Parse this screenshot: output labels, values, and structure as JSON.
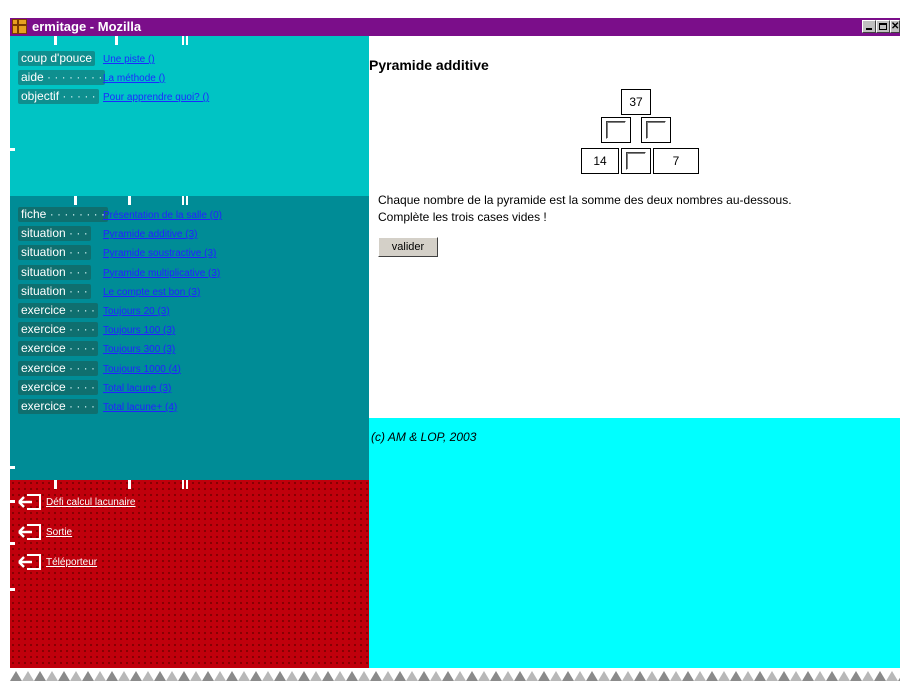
{
  "window": {
    "title": "ermitage - Mozilla"
  },
  "help": {
    "items": [
      {
        "tag": "coup d'pouce",
        "dots": "",
        "link": "Une piste ()"
      },
      {
        "tag": "aide",
        "dots": " · · · · · · · ·",
        "link": "La méthode ()"
      },
      {
        "tag": "objectif",
        "dots": " · · · · ·",
        "link": "Pour apprendre quoi? ()"
      }
    ]
  },
  "activities": {
    "items": [
      {
        "tag": "fiche",
        "dots": " · · · · · · · ·",
        "link": "Présentation de la salle (0)"
      },
      {
        "tag": "situation",
        "dots": " · · ·",
        "link": "Pyramide additive (3)"
      },
      {
        "tag": "situation",
        "dots": " · · ·",
        "link": "Pyramide soustractive (3)"
      },
      {
        "tag": "situation",
        "dots": " · · ·",
        "link": "Pyramide multiplicative (3)"
      },
      {
        "tag": "situation",
        "dots": " · · ·",
        "link": "Le compte est bon (3)"
      },
      {
        "tag": "exercice",
        "dots": " · · · ·",
        "link": "Toujours 20 (3)"
      },
      {
        "tag": "exercice",
        "dots": " · · · ·",
        "link": "Toujours 100 (3)"
      },
      {
        "tag": "exercice",
        "dots": " · · · ·",
        "link": "Toujours 300 (3)"
      },
      {
        "tag": "exercice",
        "dots": " · · · ·",
        "link": "Toujours 1000 (4)"
      },
      {
        "tag": "exercice",
        "dots": " · · · ·",
        "link": "Total lacune (3)"
      },
      {
        "tag": "exercice",
        "dots": " · · · ·",
        "link": "Total lacune+ (4)"
      }
    ]
  },
  "exits": {
    "items": [
      {
        "label": "Défi calcul lacunaire",
        "icon": "exit-door-icon"
      },
      {
        "label": "Sortie",
        "icon": "exit-door-icon"
      },
      {
        "label": "Téléporteur",
        "icon": "exit-door-icon"
      }
    ]
  },
  "exercise": {
    "title": "Pyramide additive",
    "pyramid": {
      "top": "37",
      "middle": [
        "",
        ""
      ],
      "bottom": [
        "14",
        "",
        "7"
      ]
    },
    "instructions": [
      "Chaque nombre de la pyramide est la somme des deux nombres au-dessous.",
      "Complète les trois cases vides !"
    ],
    "submit_label": "valider"
  },
  "footer": {
    "copyright": "(c) AM & LOP, 2003"
  },
  "colors": {
    "titlebar": "#7b0e8a",
    "help_panel": "#00c4c4",
    "activities_panel": "#008c96",
    "exits_panel": "#c0000c",
    "footer": "#00ffff",
    "link": "#2222ff"
  }
}
